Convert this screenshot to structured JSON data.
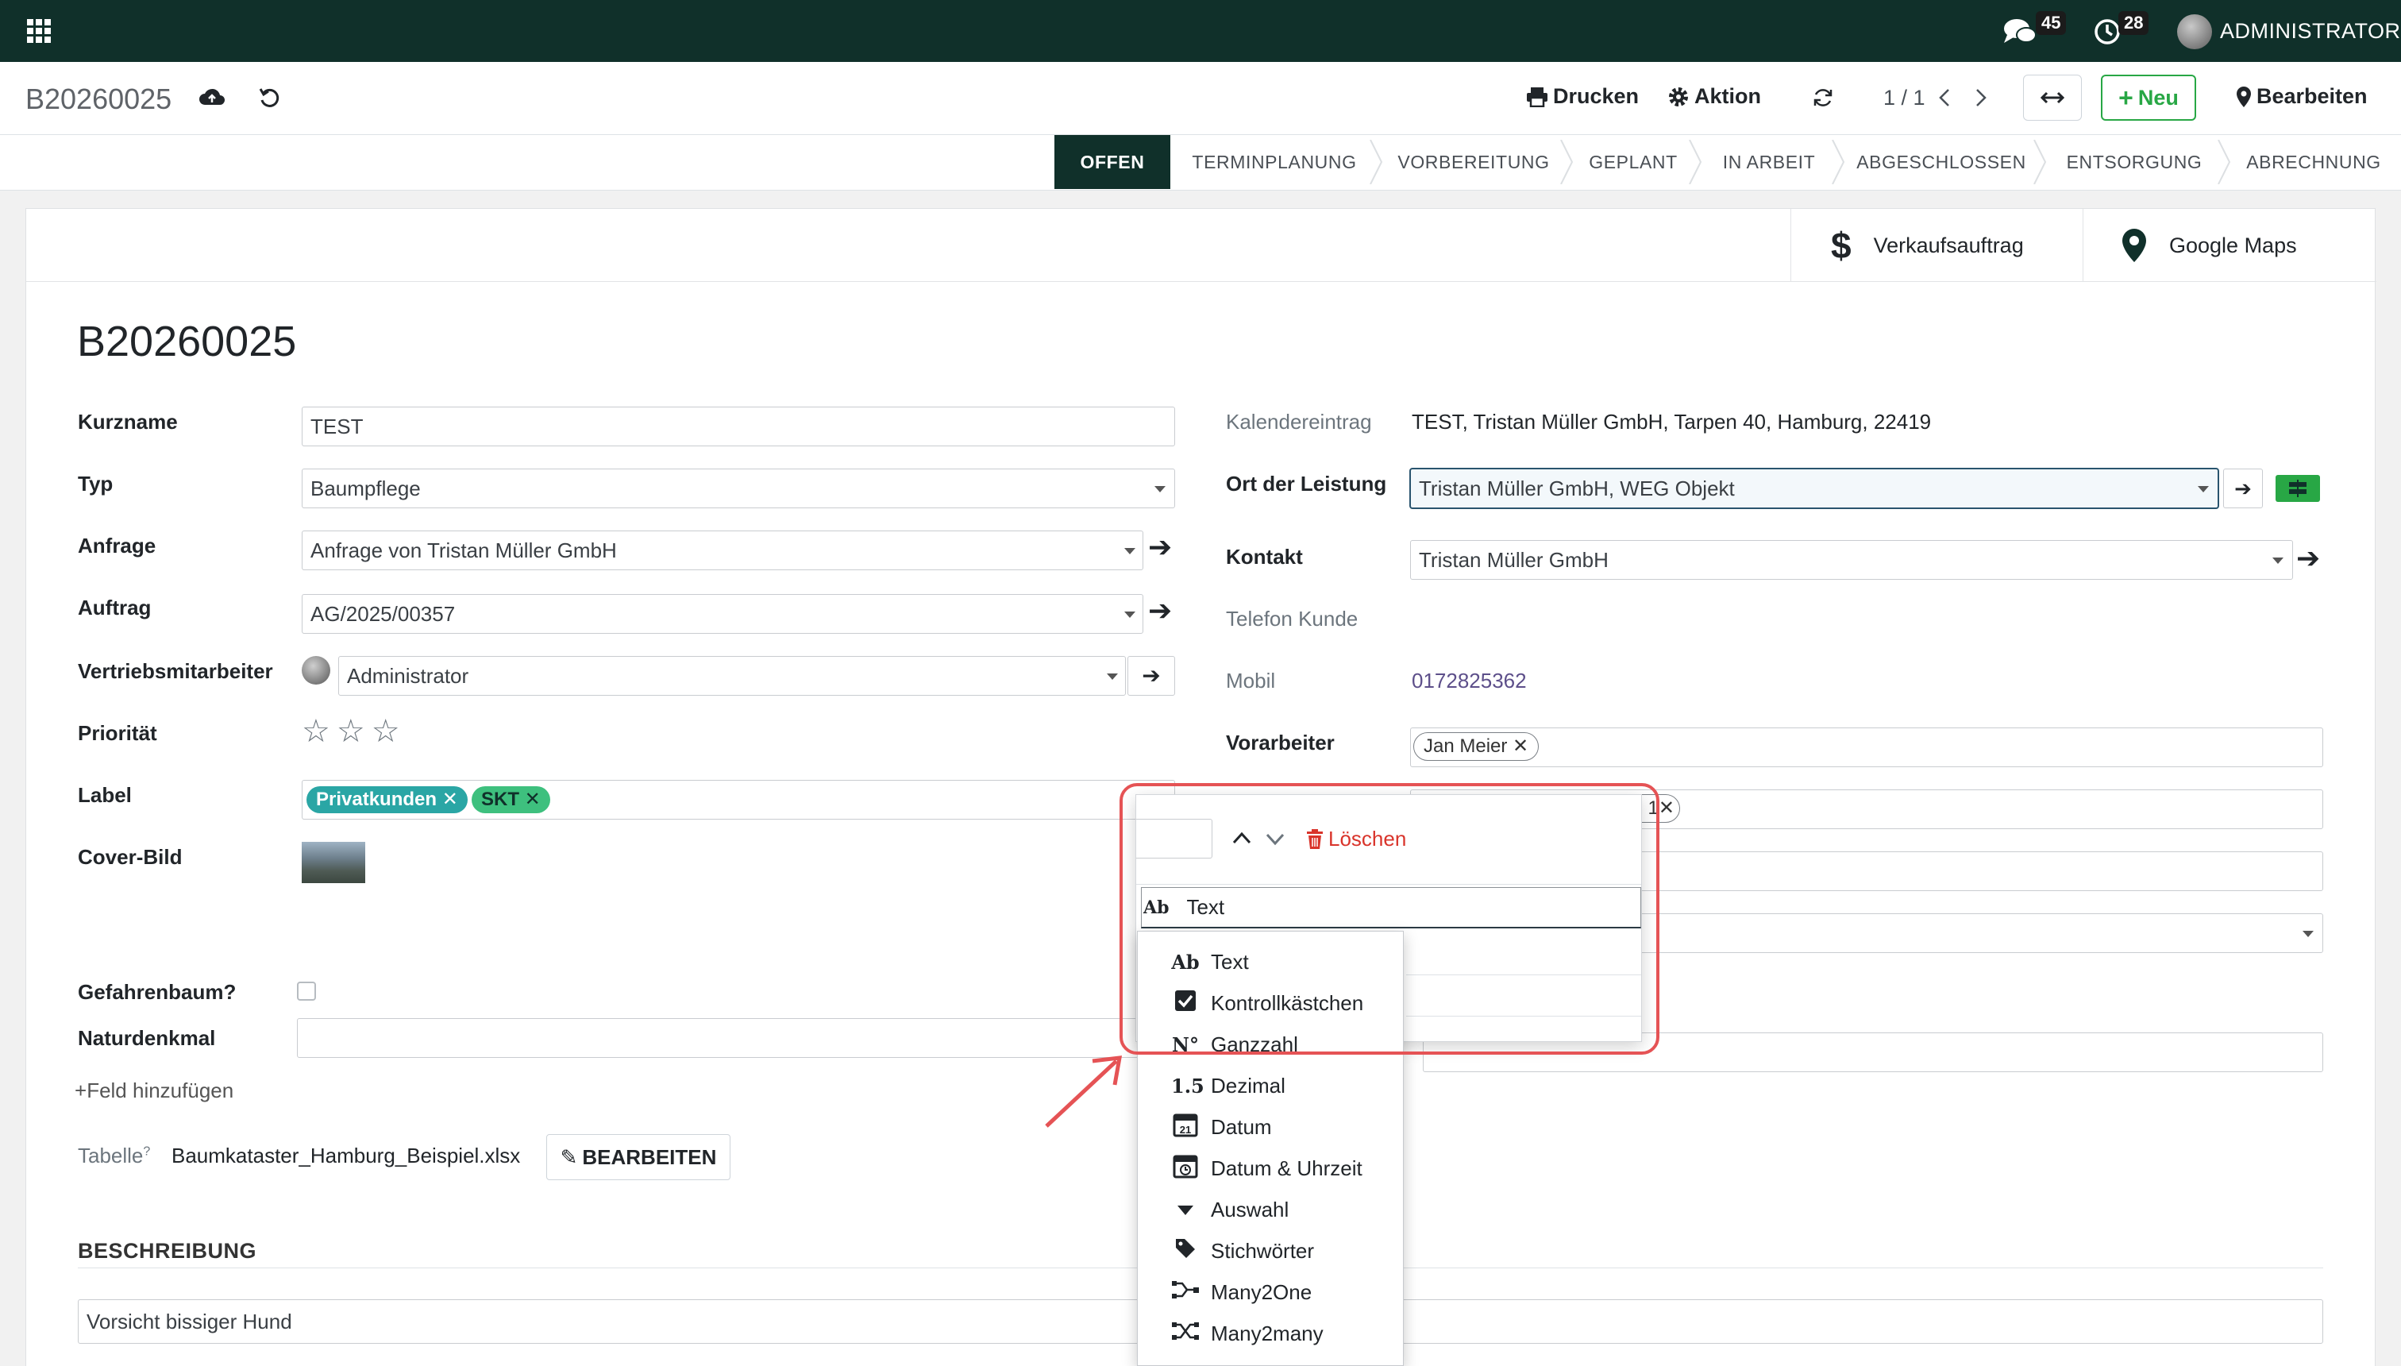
{
  "navbar": {
    "messages_count": "45",
    "activities_count": "28",
    "user": "ADMINISTRATOR"
  },
  "control_panel": {
    "breadcrumb": "B20260025",
    "print": "Drucken",
    "action": "Aktion",
    "pager": "1 / 1",
    "new": "Neu",
    "edit": "Bearbeiten"
  },
  "statusbar": {
    "stages": [
      "OFFEN",
      "TERMINPLANUNG",
      "VORBEREITUNG",
      "GEPLANT",
      "IN ARBEIT",
      "ABGESCHLOSSEN",
      "ENTSORGUNG",
      "ABRECHNUNG"
    ],
    "active": "OFFEN"
  },
  "smart_buttons": {
    "sales_order": "Verkaufsauftrag",
    "maps": "Google Maps"
  },
  "form": {
    "title": "B20260025",
    "left": {
      "kurzname_label": "Kurzname",
      "kurzname": "TEST",
      "typ_label": "Typ",
      "typ": "Baumpflege",
      "anfrage_label": "Anfrage",
      "anfrage": "Anfrage von Tristan Müller GmbH",
      "auftrag_label": "Auftrag",
      "auftrag": "AG/2025/00357",
      "vertrieb_label": "Vertriebsmitarbeiter",
      "vertrieb": "Administrator",
      "prioritaet_label": "Priorität",
      "label_label": "Label",
      "tags": [
        "Privatkunden",
        "SKT"
      ],
      "cover_label": "Cover-Bild",
      "gefahrenbaum_label": "Gefahrenbaum?",
      "naturdenkmal_label": "Naturdenkmal",
      "add_field": "Feld hinzufügen",
      "tabelle_label": "Tabelle",
      "tabelle_sup": "?",
      "tabelle_file": "Baumkataster_Hamburg_Beispiel.xlsx",
      "tabelle_edit": "BEARBEITEN"
    },
    "right": {
      "kalender_label": "Kalendereintrag",
      "kalender": "TEST, Tristan Müller GmbH, Tarpen 40, Hamburg, 22419",
      "ort_label": "Ort der Leistung",
      "ort": "Tristan Müller GmbH, WEG Objekt",
      "kontakt_label": "Kontakt",
      "kontakt": "Tristan Müller GmbH",
      "telefon_label": "Telefon Kunde",
      "mobil_label": "Mobil",
      "mobil": "0172825362",
      "vorarbeiter_label": "Vorarbeiter",
      "vorarbeiter": "Jan Meier",
      "row2_tag_fragment": "1"
    },
    "beschreibung_label": "BESCHREIBUNG",
    "beschreibung": "Vorsicht bissiger Hund"
  },
  "property_popover": {
    "delete": "Löschen",
    "type_value": "Text",
    "type_icon": "Ab"
  },
  "type_dropdown": {
    "items": [
      {
        "icon": "Ab",
        "label": "Text"
      },
      {
        "icon": "checkbox-icon",
        "label": "Kontrollkästchen"
      },
      {
        "icon": "N°",
        "label": "Ganzzahl"
      },
      {
        "icon": "1.5",
        "label": "Dezimal"
      },
      {
        "icon": "calendar-icon",
        "label": "Datum"
      },
      {
        "icon": "calendar-clock-icon",
        "label": "Datum & Uhrzeit"
      },
      {
        "icon": "caret-down-icon",
        "label": "Auswahl"
      },
      {
        "icon": "tag-icon",
        "label": "Stichwörter"
      },
      {
        "icon": "many2one-icon",
        "label": "Many2One"
      },
      {
        "icon": "many2many-icon",
        "label": "Many2many"
      }
    ]
  },
  "colors": {
    "navbar": "#10302a",
    "tag_privatkunden": "#2aa6a5",
    "tag_skt": "#3ec07e",
    "highlight": "#e55355",
    "delete": "#d9342b",
    "new_button": "#28a745"
  }
}
